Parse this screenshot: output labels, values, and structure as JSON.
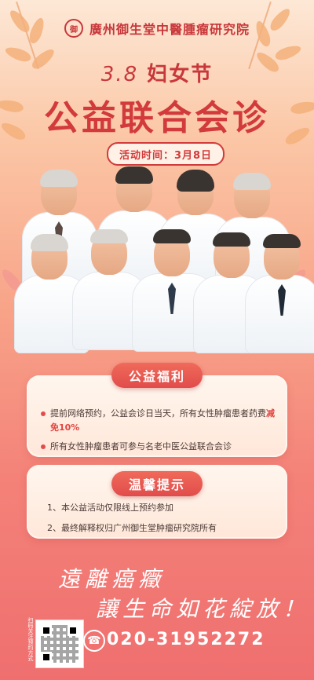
{
  "header": {
    "logo_mark": "御",
    "hospital_name": "廣州御生堂中醫腫瘤研究院"
  },
  "event": {
    "subtitle_num": "3.8",
    "subtitle_text": "妇女节",
    "title": "公益联合会诊",
    "date_label": "活动时间：3月8日"
  },
  "benefits": {
    "title": "公益福利",
    "items": [
      {
        "text_before": "提前网络预约，公益会诊日当天，所有女性肿瘤患者药费",
        "highlight": "减免10%"
      },
      {
        "text": "所有女性肿瘤患者可参与名老中医公益联合会诊"
      }
    ]
  },
  "tips": {
    "title": "温馨提示",
    "items": [
      "1、本公益活动仅限线上预约参加",
      "2、最终解释权归广州御生堂肿瘤研究院所有"
    ]
  },
  "slogan": {
    "line1": "遠離癌癥",
    "line2": "讓生命如花綻放！"
  },
  "contact": {
    "qr_caption": "扫码关注预约方式",
    "phone": "020-31952272"
  },
  "colors": {
    "brand_red": "#d23a3b",
    "accent_red": "#e14c4b"
  }
}
